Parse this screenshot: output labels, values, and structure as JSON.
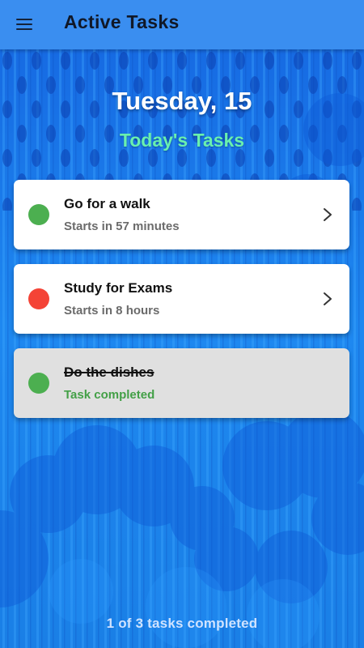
{
  "app_bar": {
    "menu_icon": "hamburger-menu-icon",
    "title": "Active Tasks",
    "background_color": "#3a8ef0"
  },
  "header": {
    "date": "Tuesday, 15",
    "section_title": "Today's Tasks"
  },
  "tasks": [
    {
      "title": "Go for a walk",
      "subtitle": "Starts in 57 minutes",
      "status_color": "#4caf50",
      "completed": false,
      "trailing_icon": "chevron-right-icon"
    },
    {
      "title": "Study for Exams",
      "subtitle": "Starts in 8 hours",
      "status_color": "#f44336",
      "completed": false,
      "trailing_icon": "chevron-right-icon"
    },
    {
      "title": "Do the dishes",
      "subtitle": "Task completed",
      "status_color": "#4caf50",
      "completed": true
    }
  ],
  "footer": {
    "status": "1 of 3 tasks completed"
  },
  "colors": {
    "background": "#1a78e8",
    "heading_accent": "#69f0ae",
    "completed_text": "#43a047",
    "completed_card": "#e0e0e0"
  }
}
